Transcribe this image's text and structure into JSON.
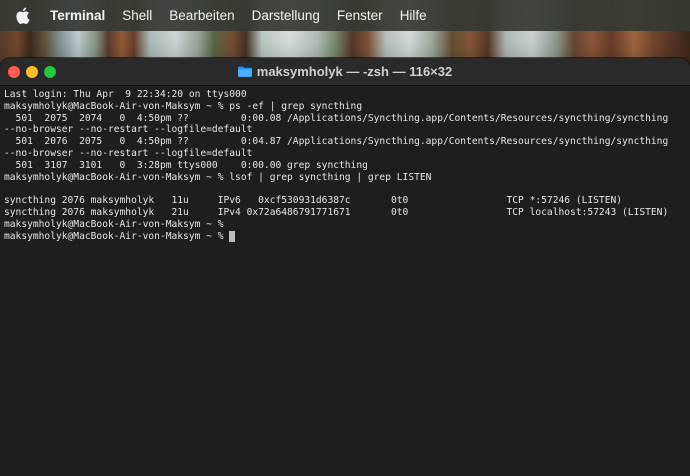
{
  "menubar": {
    "app_name": "Terminal",
    "items": [
      "Shell",
      "Bearbeiten",
      "Darstellung",
      "Fenster",
      "Hilfe"
    ]
  },
  "window": {
    "title": "maksymholyk — -zsh — 116×32"
  },
  "terminal": {
    "lines": [
      "Last login: Thu Apr  9 22:34:20 on ttys000",
      "maksymholyk@MacBook-Air-von-Maksym ~ % ps -ef | grep syncthing",
      "  501  2075  2074   0  4:50pm ??         0:00.08 /Applications/Syncthing.app/Contents/Resources/syncthing/syncthing",
      "--no-browser --no-restart --logfile=default",
      "  501  2076  2075   0  4:50pm ??         0:04.87 /Applications/Syncthing.app/Contents/Resources/syncthing/syncthing",
      "--no-browser --no-restart --logfile=default",
      "  501  3107  3101   0  3:28pm ttys000    0:00.00 grep syncthing",
      "maksymholyk@MacBook-Air-von-Maksym ~ % lsof | grep syncthing | grep LISTEN",
      "",
      "syncthing 2076 maksymholyk   11u     IPv6   0xcf530931d6387c       0t0                 TCP *:57246 (LISTEN)",
      "syncthing 2076 maksymholyk   21u     IPv4 0x72a6486791771671       0t0                 TCP localhost:57243 (LISTEN)",
      "maksymholyk@MacBook-Air-von-Maksym ~ %",
      "maksymholyk@MacBook-Air-von-Maksym ~ % "
    ]
  },
  "colors": {
    "terminal_bg": "#1e1e1e",
    "terminal_fg": "#e6e6e6",
    "close": "#fe5f57",
    "minimize": "#febc2e",
    "zoom": "#28c840"
  },
  "icons": {
    "apple": "apple-logo-icon",
    "folder": "folder-icon"
  }
}
